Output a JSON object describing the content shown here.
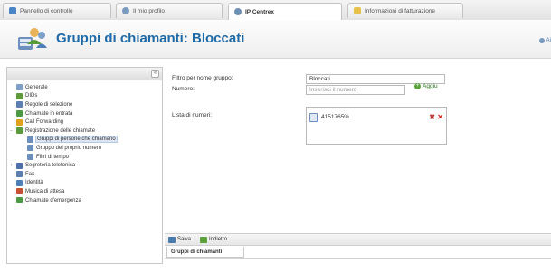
{
  "tabs": [
    {
      "label": "Pannello di controllo",
      "icon": "panel-icon",
      "color": "#4a86c5"
    },
    {
      "label": "Il mio profilo",
      "icon": "profile-icon",
      "color": "#7a9bbf"
    },
    {
      "label": "IP Centrex",
      "icon": "centrex-icon",
      "color": "#6b8fb5"
    },
    {
      "label": "Informazioni di fatturazione",
      "icon": "billing-icon",
      "color": "#e7c14a"
    }
  ],
  "header": {
    "title": "Gruppi di chiamanti: Bloccati",
    "help_label": "Ai"
  },
  "sidebar": {
    "collapse_symbol": "«",
    "items": [
      {
        "label": "Generale",
        "icon": "general-icon",
        "color": "#7ca0c8",
        "depth": 0,
        "expander": ""
      },
      {
        "label": "DIDs",
        "icon": "dids-icon",
        "color": "#5e9a3c",
        "depth": 0,
        "expander": ""
      },
      {
        "label": "Regole di selezione",
        "icon": "rules-icon",
        "color": "#5a7fb0",
        "depth": 0,
        "expander": ""
      },
      {
        "label": "Chiamate in entrata",
        "icon": "incoming-calls-icon",
        "color": "#4d9a45",
        "depth": 0,
        "expander": ""
      },
      {
        "label": "Call Forwarding",
        "icon": "call-forwarding-icon",
        "color": "#e0a21e",
        "depth": 0,
        "expander": ""
      },
      {
        "label": "Registrazione delle chiamate",
        "icon": "call-screening-icon",
        "color": "#5c9a3e",
        "depth": 0,
        "expander": "−"
      },
      {
        "label": "Gruppi di persone che chiamano",
        "icon": "caller-groups-icon",
        "color": "#6c8fbd",
        "depth": 1,
        "expander": "",
        "selected": true
      },
      {
        "label": "Gruppo del proprio numero",
        "icon": "own-number-group-icon",
        "color": "#6c8fbd",
        "depth": 1,
        "expander": ""
      },
      {
        "label": "Filtri di tempo",
        "icon": "time-filter-icon",
        "color": "#6c8fbd",
        "depth": 1,
        "expander": ""
      },
      {
        "label": "Segreteria telefonica",
        "icon": "voicemail-icon",
        "color": "#4e6fa8",
        "depth": 0,
        "expander": "+"
      },
      {
        "label": "Fax",
        "icon": "fax-icon",
        "color": "#5b7fae",
        "depth": 0,
        "expander": ""
      },
      {
        "label": "Identità",
        "icon": "identity-icon",
        "color": "#4d7fb8",
        "depth": 0,
        "expander": ""
      },
      {
        "label": "Musica di attesa",
        "icon": "music-on-hold-icon",
        "color": "#c4512f",
        "depth": 0,
        "expander": ""
      },
      {
        "label": "Chiamate d'emergenza",
        "icon": "emergency-calls-icon",
        "color": "#4d9a45",
        "depth": 0,
        "expander": ""
      }
    ]
  },
  "form": {
    "group_name_label": "Filtro per nome gruppo:",
    "group_name_value": "Bloccati",
    "number_label": "Numero:",
    "number_placeholder": "Inserisci il numero",
    "add_label": "Aggiu",
    "list_label": "Lista di numeri:",
    "numbers": [
      "4151765%"
    ]
  },
  "toolbar": {
    "save_label": "Salva",
    "back_label": "Indietro"
  },
  "bottom_tab": {
    "label": "Gruppi di chiamanti"
  }
}
